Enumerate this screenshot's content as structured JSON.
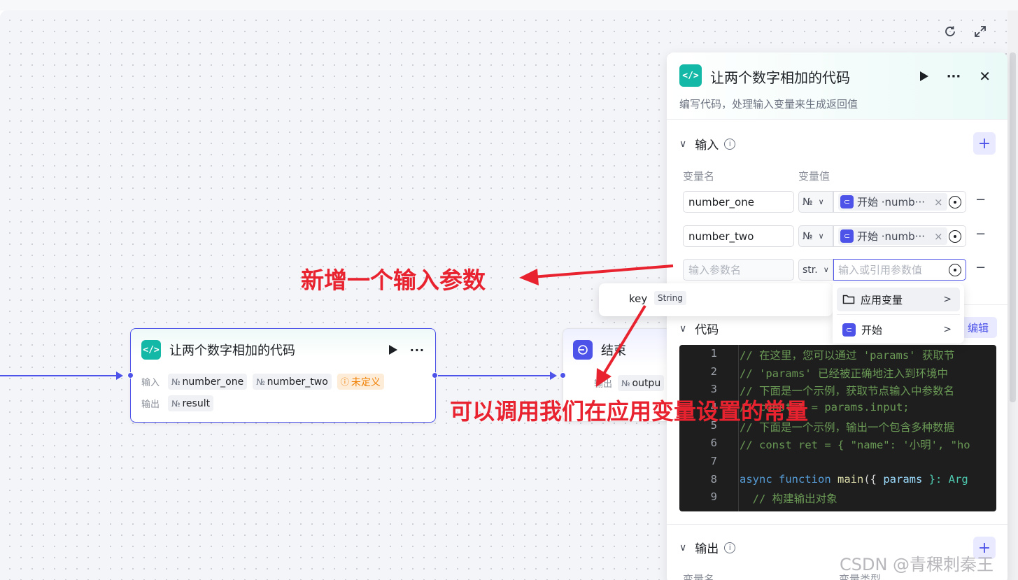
{
  "canvas": {
    "refresh_icon": "refresh-icon",
    "fullscreen_icon": "expand-icon"
  },
  "code_node": {
    "title": "让两个数字相加的代码",
    "input_label": "输入",
    "output_label": "输出",
    "inputs": [
      {
        "type": "№",
        "name": "number_one"
      },
      {
        "type": "№",
        "name": "number_two"
      },
      {
        "type": "ⓘ",
        "name": "未定义",
        "warning": true
      }
    ],
    "outputs": [
      {
        "type": "№",
        "name": "result"
      }
    ]
  },
  "end_node": {
    "title": "结束",
    "output_label": "输出",
    "output_type": "№",
    "output_name": "outpu"
  },
  "panel": {
    "title": "让两个数字相加的代码",
    "description": "编写代码，处理输入变量来生成返回值",
    "input_section": "输入",
    "col_var_name": "变量名",
    "col_var_value": "变量值",
    "rows": [
      {
        "name": "number_one",
        "type": "№",
        "ref_prefix": "开始 · ",
        "ref_name": "numb···"
      },
      {
        "name": "number_two",
        "type": "№",
        "ref_prefix": "开始 · ",
        "ref_name": "numb···"
      }
    ],
    "new_row": {
      "name_placeholder": "输入参数名",
      "type": "str.",
      "value_placeholder": "输入或引用参数值"
    },
    "code_section": "代码",
    "edit_label": "编辑",
    "code_lines": [
      {
        "n": "1",
        "text": "// 在这里，您可以通过 'params'  获取节"
      },
      {
        "n": "2",
        "text": "// 'params' 已经被正确地注入到环境中"
      },
      {
        "n": "3",
        "text": "// 下面是一个示例，获取节点输入中参数名"
      },
      {
        "n": "4",
        "text": "// const        t = params.input;"
      },
      {
        "n": "5",
        "text": "// 下面是一个示例，输出一个包含多种数据"
      },
      {
        "n": "6",
        "text": "// const ret = { \"name\": '小明', \"ho"
      },
      {
        "n": "7",
        "text": ""
      },
      {
        "n": "8",
        "kw1": "async",
        "kw2": "function",
        "fn": "main",
        "rest1": "({ ",
        "param": "params",
        "rest2": " }: Arg"
      },
      {
        "n": "9",
        "text": "  // 构建输出对象"
      }
    ],
    "output_section": "输出",
    "out_col_name": "变量名",
    "out_col_type": "变量类型"
  },
  "dropdown": {
    "key_label": "key",
    "key_type": "String",
    "items": [
      {
        "label": "应用变量",
        "icon": "folder-icon"
      },
      {
        "label": "开始",
        "icon": "start-node-icon"
      }
    ]
  },
  "annotations": {
    "new_param": "新增一个输入参数",
    "call_constants": "可以调用我们在应用变量设置的常量"
  },
  "watermark": "CSDN @青稞刺秦王",
  "colors": {
    "accent": "#4d53e8",
    "code_icon": "#14b8a6",
    "annotation": "#e8232f"
  }
}
